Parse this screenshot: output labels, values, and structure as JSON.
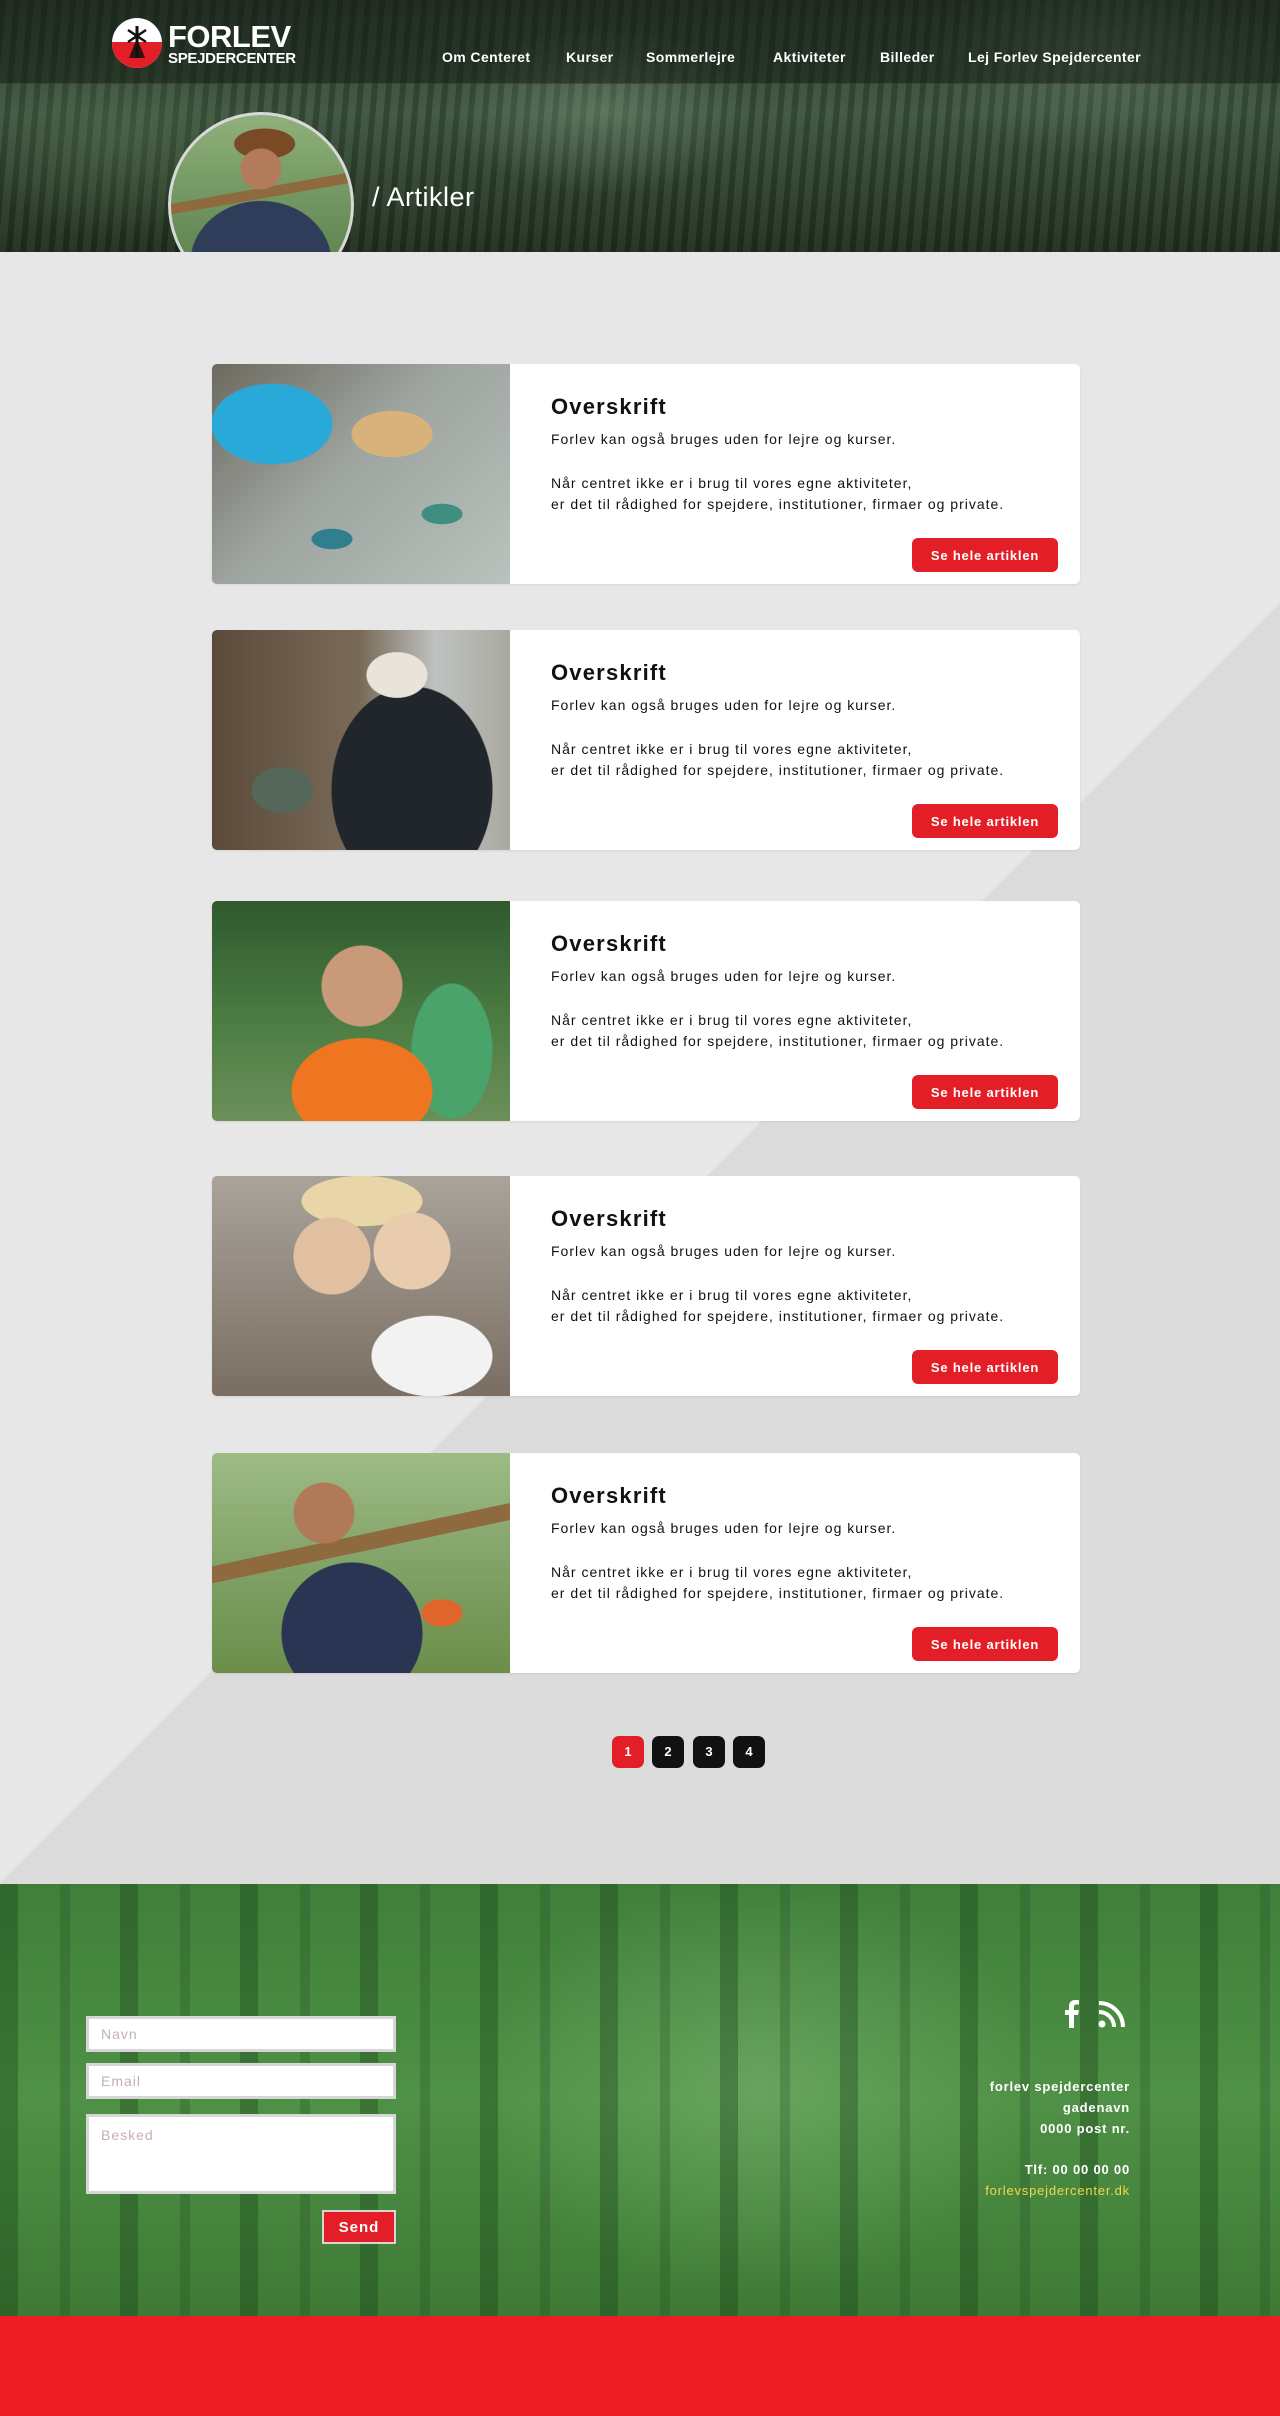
{
  "brand": {
    "line1": "FORLEV",
    "line2": "SPEJDERCENTER",
    "red": "#e41e26"
  },
  "nav": [
    {
      "label": "Om Centeret"
    },
    {
      "label": "Kurser"
    },
    {
      "label": "Sommerlejre"
    },
    {
      "label": "Aktiviteter"
    },
    {
      "label": "Billeder"
    },
    {
      "label": "Lej Forlev Spejdercenter"
    }
  ],
  "hero": {
    "title": "/ Artikler"
  },
  "articles": [
    {
      "heading": "Overskrift",
      "intro": "Forlev kan også bruges uden for lejre og kurser.",
      "body1": "Når centret ikke er i brug til vores egne aktiviteter,",
      "body2": "er det til rådighed for spejdere, institutioner, firmaer og private.",
      "button": "Se hele artiklen"
    },
    {
      "heading": "Overskrift",
      "intro": "Forlev kan også bruges uden for lejre og kurser.",
      "body1": "Når centret ikke er i brug til vores egne aktiviteter,",
      "body2": "er det til rådighed for spejdere, institutioner, firmaer og private.",
      "button": "Se hele artiklen"
    },
    {
      "heading": "Overskrift",
      "intro": "Forlev kan også bruges uden for lejre og kurser.",
      "body1": "Når centret ikke er i brug til vores egne aktiviteter,",
      "body2": "er det til rådighed for spejdere, institutioner, firmaer og private.",
      "button": "Se hele artiklen"
    },
    {
      "heading": "Overskrift",
      "intro": "Forlev kan også bruges uden for lejre og kurser.",
      "body1": "Når centret ikke er i brug til vores egne aktiviteter,",
      "body2": "er det til rådighed for spejdere, institutioner, firmaer og private.",
      "button": "Se hele artiklen"
    },
    {
      "heading": "Overskrift",
      "intro": "Forlev kan også bruges uden for lejre og kurser.",
      "body1": "Når centret ikke er i brug til vores egne aktiviteter,",
      "body2": "er det til rådighed for spejdere, institutioner, firmaer og private.",
      "button": "Se hele artiklen"
    }
  ],
  "pagination": {
    "pages": [
      "1",
      "2",
      "3",
      "4"
    ],
    "current": "1"
  },
  "contact_form": {
    "name_placeholder": "Navn",
    "email_placeholder": "Email",
    "message_placeholder": "Besked",
    "send_label": "Send"
  },
  "footer_info": {
    "name": "forlev spejdercenter",
    "street": "gadenavn",
    "postal": "0000 post nr.",
    "phone": "Tlf: 00 00 00 00",
    "website": "forlevspejdercenter.dk",
    "link_color": "#f0d850"
  },
  "social": [
    {
      "icon": "facebook-icon"
    },
    {
      "icon": "rss-icon"
    }
  ]
}
